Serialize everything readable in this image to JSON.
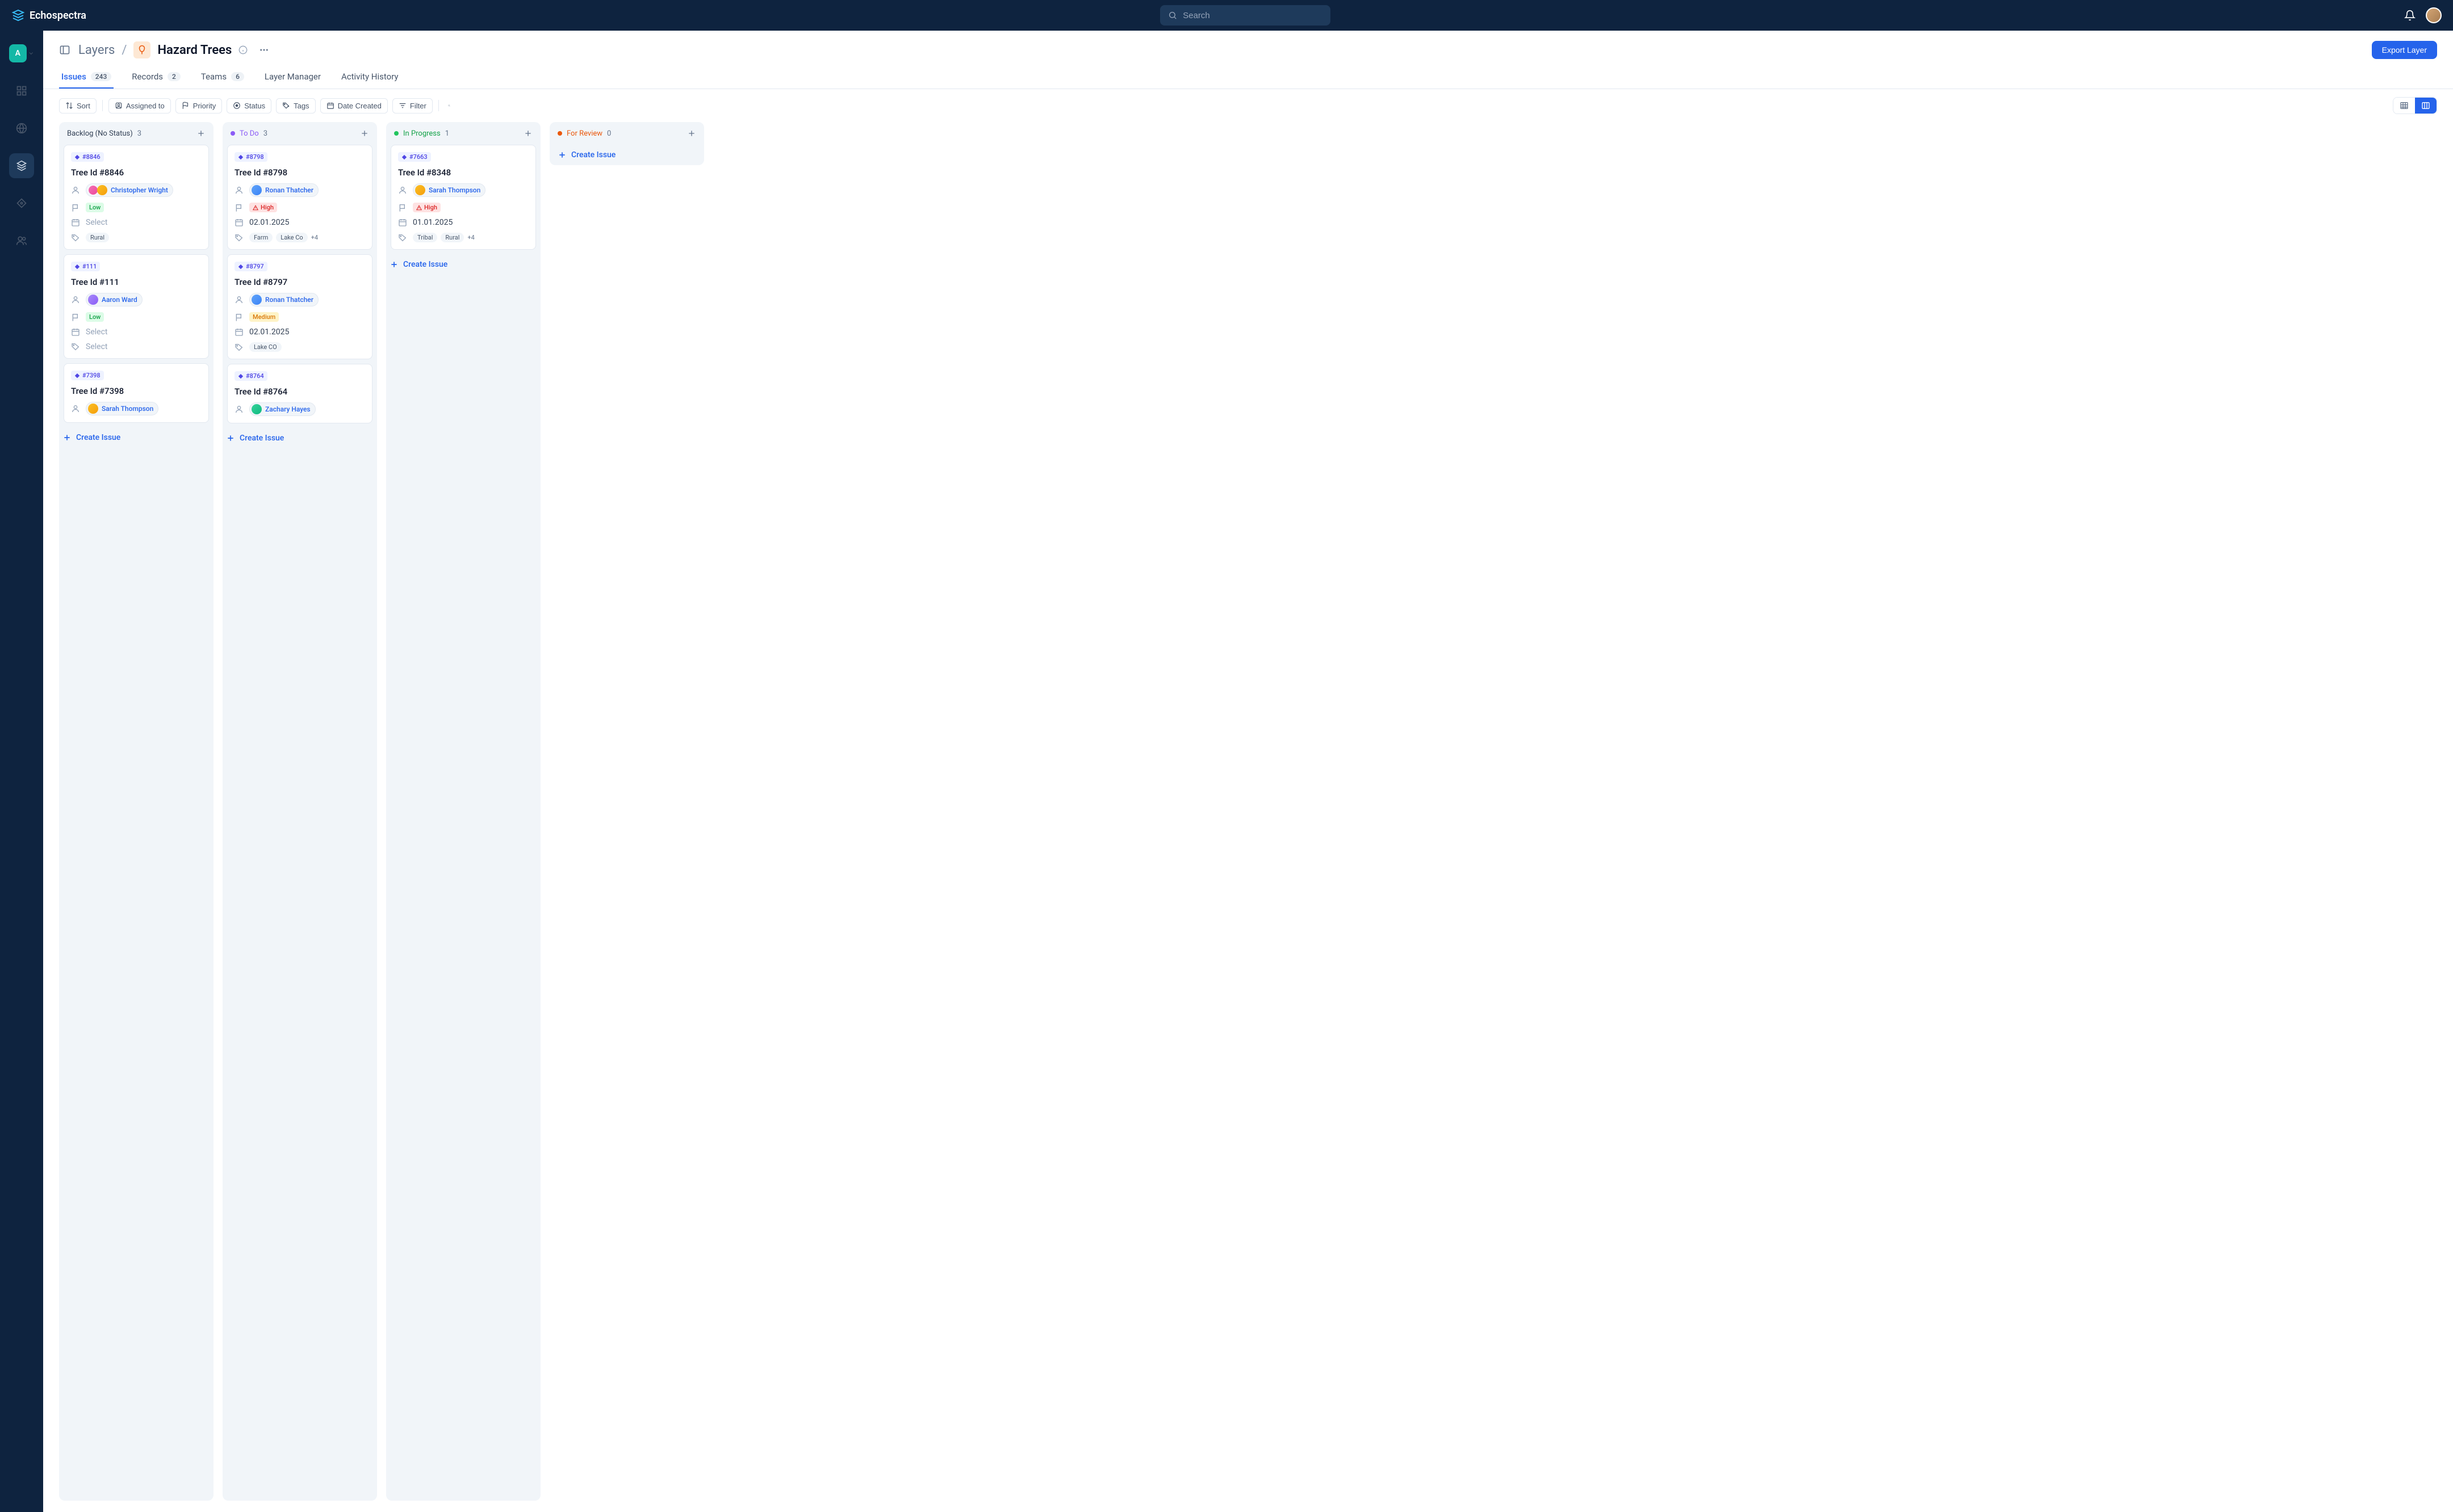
{
  "brand": {
    "name": "Echospectra"
  },
  "search": {
    "placeholder": "Search"
  },
  "sidenav": {
    "workspace_letter": "A"
  },
  "breadcrumb": {
    "root": "Layers",
    "title": "Hazard Trees"
  },
  "export_button": "Export Layer",
  "tabs": [
    {
      "label": "Issues",
      "count": "243",
      "active": true
    },
    {
      "label": "Records",
      "count": "2"
    },
    {
      "label": "Teams",
      "count": "6"
    },
    {
      "label": "Layer Manager"
    },
    {
      "label": "Activity History"
    }
  ],
  "filters": {
    "sort": "Sort",
    "assigned_to": "Assigned to",
    "priority": "Priority",
    "status": "Status",
    "tags": "Tags",
    "date_created": "Date Created",
    "filter": "Filter"
  },
  "create_issue_label": "Create Issue",
  "columns": [
    {
      "id": "backlog",
      "title": "Backlog (No Status)",
      "count": "3",
      "cards": [
        {
          "id": "#8846",
          "title": "Tree Id #8846",
          "assignee": "Christopher Wright",
          "assignee_stack": true,
          "priority": "Low",
          "priority_level": "low",
          "date": null,
          "date_placeholder": "Select",
          "tags": [
            "Rural"
          ],
          "tags_placeholder": null
        },
        {
          "id": "#111",
          "title": "Tree Id #111",
          "assignee": "Aaron Ward",
          "priority": "Low",
          "priority_level": "low",
          "date": null,
          "date_placeholder": "Select",
          "tags": null,
          "tags_placeholder": "Select"
        },
        {
          "id": "#7398",
          "title": "Tree Id #7398",
          "assignee": "Sarah Thompson"
        }
      ]
    },
    {
      "id": "todo",
      "title": "To Do",
      "count": "3",
      "cards": [
        {
          "id": "#8798",
          "title": "Tree Id #8798",
          "assignee": "Ronan Thatcher",
          "priority": "High",
          "priority_level": "high",
          "date": "02.01.2025",
          "tags": [
            "Farm",
            "Lake Co"
          ],
          "tags_more": "+4"
        },
        {
          "id": "#8797",
          "title": "Tree Id #8797",
          "assignee": "Ronan Thatcher",
          "priority": "Medium",
          "priority_level": "medium",
          "date": "02.01.2025",
          "tags": [
            "Lake CO"
          ]
        },
        {
          "id": "#8764",
          "title": "Tree Id #8764",
          "assignee": "Zachary Hayes"
        }
      ]
    },
    {
      "id": "progress",
      "title": "In Progress",
      "count": "1",
      "cards": [
        {
          "id": "#7663",
          "title": "Tree Id #8348",
          "assignee": "Sarah Thompson",
          "priority": "High",
          "priority_level": "high",
          "date": "01.01.2025",
          "tags": [
            "Tribal",
            "Rural"
          ],
          "tags_more": "+4"
        }
      ]
    },
    {
      "id": "review",
      "title": "For Review",
      "count": "0",
      "cards": []
    }
  ]
}
